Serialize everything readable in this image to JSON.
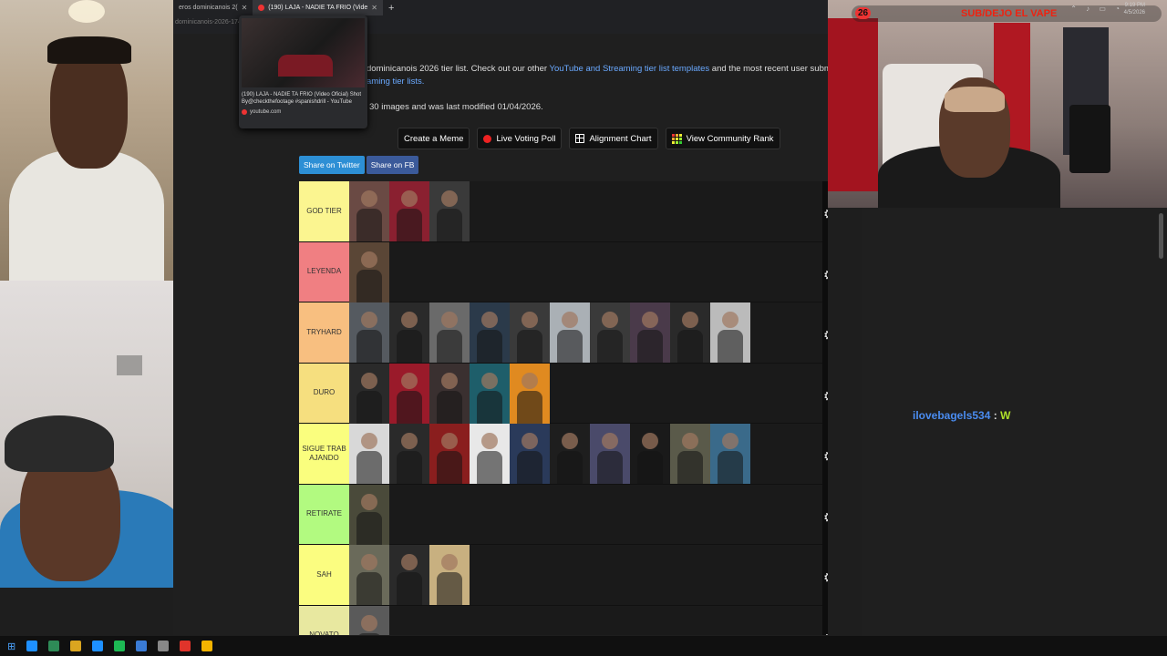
{
  "browser": {
    "tabs": [
      {
        "label": "eros dominicanois 2(",
        "active": false
      },
      {
        "label": "(190) LAJA - NADIE TA FRIO (Vide",
        "active": true
      }
    ],
    "url_fragment": "dominicanois-2026-174"
  },
  "tab_preview": {
    "title": "(190) LAJA - NADIE TA FRIO (Video Oficial) Shot By@checkthefootage #spanishdrill - YouTube",
    "source": "youtube.com"
  },
  "page": {
    "intro_prefix": "dominicanois 2026 tier list. Check out our other ",
    "intro_link": "YouTube and Streaming tier list templates",
    "intro_suffix": " and the most recent user subm",
    "intro_line2": "aming tier lists.",
    "modified": "30 images and was last modified 01/04/2026.",
    "buttons": {
      "meme": "Create a Meme",
      "poll": "Live Voting Poll",
      "alignment": "Alignment Chart",
      "community": "View Community Rank"
    },
    "share": {
      "twitter": "Share on Twitter",
      "fb": "Share on FB"
    }
  },
  "tiers": [
    {
      "label": "GOD TIER",
      "color": "#fbf590",
      "items": [
        "#6a4a44",
        "#8a2030",
        "#3a3a3a"
      ]
    },
    {
      "label": "LEYENDA",
      "color": "#f07f82",
      "items": [
        "#5a4636"
      ]
    },
    {
      "label": "TRYHARD",
      "color": "#f8bf80",
      "items": [
        "#555a60",
        "#2a2a2a",
        "#6a6a6a",
        "#2b3a4a",
        "#3a3a3a",
        "#aab0b5",
        "#3a3a3a",
        "#4a3a4a",
        "#2a2a2a",
        "#bbbbbb"
      ]
    },
    {
      "label": "DURO",
      "color": "#f6df7f",
      "items": [
        "#2a2a2a",
        "#9a1a2a",
        "#3a3030",
        "#1e5e6a",
        "#e08a20"
      ]
    },
    {
      "label": "SIGUE TRAB AJANDO",
      "color": "#fafe7e",
      "items": [
        "#d8d8d8",
        "#2a2a2a",
        "#8a1e1e",
        "#e8e8e8",
        "#2a3a5a",
        "#1e1e1e",
        "#4a4a6a",
        "#1a1a1a",
        "#5a5a4a",
        "#3a6a8a"
      ]
    },
    {
      "label": "RETIRATE",
      "color": "#b2fa80",
      "items": [
        "#4a4a3a"
      ]
    },
    {
      "label": "SAH",
      "color": "#fbfd80",
      "items": [
        "#6a6a5a",
        "#2a2a2a",
        "#c8b080"
      ]
    },
    {
      "label": "NOVATO",
      "color": "#e8e8a0",
      "items": [
        "#5a5a5a"
      ]
    }
  ],
  "stream": {
    "sub_count": "26",
    "sub_text": "SUB/DEJO EL VAPE"
  },
  "chat": {
    "user": "ilovebagels534",
    "separator": " : ",
    "message": "W"
  },
  "taskbar": {
    "time": "9:19 PM",
    "date": "4/5/2026",
    "icons": [
      "#1e90ff",
      "#2e8b57",
      "#daa520",
      "#1e90ff",
      "#1db954",
      "#3a7bd5",
      "#888888",
      "#e0342b",
      "#f4b400"
    ]
  }
}
